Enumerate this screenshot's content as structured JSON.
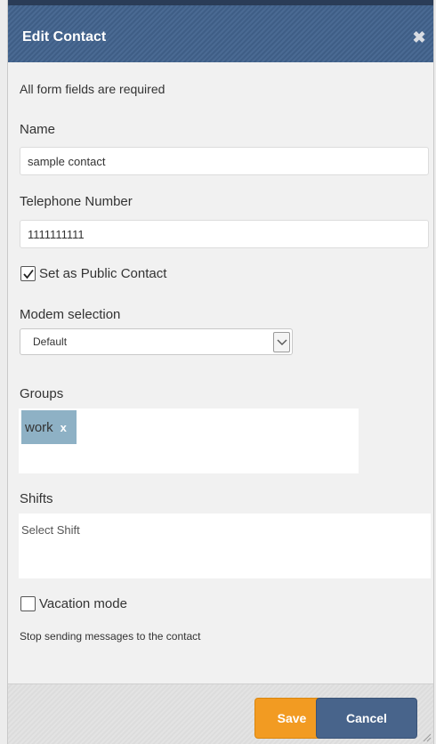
{
  "dialog": {
    "title": "Edit Contact",
    "close_glyph": "✖"
  },
  "form": {
    "required_note": "All form fields are required",
    "name_label": "Name",
    "name_value": "sample contact",
    "phone_label": "Telephone Number",
    "phone_value": "1111111111",
    "public_contact_label": "Set as Public Contact",
    "public_contact_checked": true,
    "modem_label": "Modem selection",
    "modem_value": "Default",
    "groups_label": "Groups",
    "groups": [
      {
        "label": "work",
        "remove_glyph": "x"
      }
    ],
    "shifts_label": "Shifts",
    "shifts_placeholder": "Select Shift",
    "vacation_label": "Vacation mode",
    "vacation_checked": false,
    "vacation_hint": "Stop sending messages to the contact"
  },
  "footer": {
    "save_label": "Save",
    "cancel_label": "Cancel"
  },
  "colors": {
    "titlebar": "#3f5e86",
    "save": "#f29b22",
    "cancel": "#48648b",
    "tag": "#8eb1c5"
  }
}
